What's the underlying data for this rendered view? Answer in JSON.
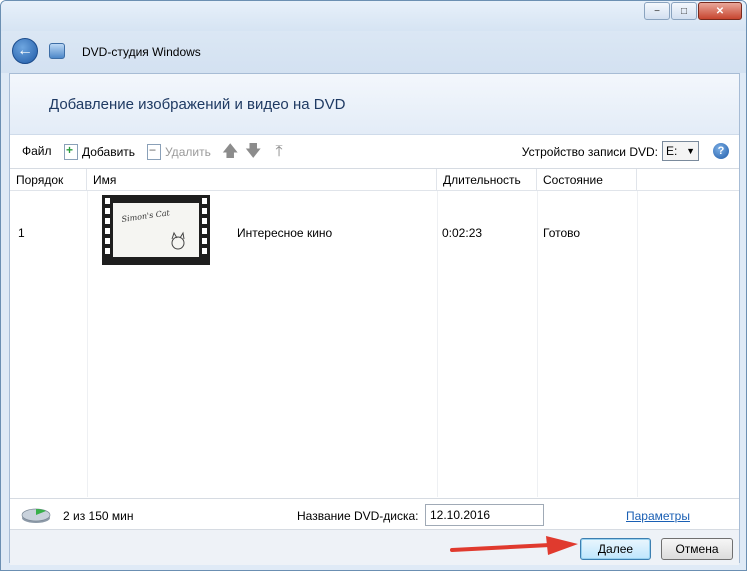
{
  "window": {
    "app_title": "DVD-студия Windows",
    "caption": {
      "minimize": "−",
      "maximize": "□",
      "close": "✕"
    }
  },
  "header": {
    "title": "Добавление изображений и видео на DVD"
  },
  "toolbar": {
    "file_label": "Файл",
    "add_label": "Добавить",
    "remove_label": "Удалить",
    "drive_label": "Устройство записи DVD:",
    "drive_value": "E:",
    "help_glyph": "?"
  },
  "table": {
    "columns": [
      "Порядок",
      "Имя",
      "Длительность",
      "Состояние"
    ],
    "rows": [
      {
        "order": "1",
        "name": "Интересное кино",
        "duration": "0:02:23",
        "status": "Готово",
        "thumbnail_text": "Simon's Cat"
      }
    ]
  },
  "footer": {
    "usage": "2 из 150 мин",
    "usage_fraction": 0.0133,
    "dvd_name_label": "Название DVD-диска:",
    "dvd_name_value": "12.10.2016",
    "params_link": "Параметры"
  },
  "buttons": {
    "next": "Далее",
    "cancel": "Отмена"
  },
  "colors": {
    "accent": "#1a5fb4",
    "annotation_arrow": "#e03a2e"
  }
}
